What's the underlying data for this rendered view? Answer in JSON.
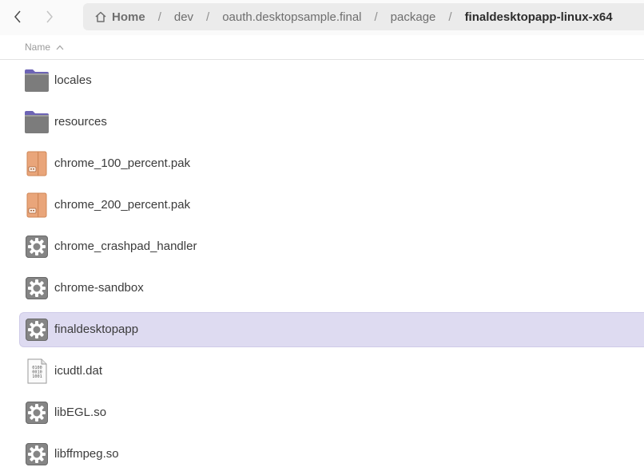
{
  "breadcrumb": {
    "home": "Home",
    "items": [
      "dev",
      "oauth.desktopsample.final",
      "package"
    ],
    "current": "finaldesktopapp-linux-x64",
    "separator": "/"
  },
  "column": {
    "name_label": "Name"
  },
  "files": [
    {
      "name": "locales",
      "icon": "folder-icon"
    },
    {
      "name": "resources",
      "icon": "folder-icon"
    },
    {
      "name": "chrome_100_percent.pak",
      "icon": "archive-icon"
    },
    {
      "name": "chrome_200_percent.pak",
      "icon": "archive-icon"
    },
    {
      "name": "chrome_crashpad_handler",
      "icon": "executable-icon"
    },
    {
      "name": "chrome-sandbox",
      "icon": "executable-icon"
    },
    {
      "name": "finaldesktopapp",
      "icon": "executable-icon",
      "selected": true
    },
    {
      "name": "icudtl.dat",
      "icon": "binary-file-icon",
      "glyph_lines": [
        "0100",
        "0010",
        "1001"
      ]
    },
    {
      "name": "libEGL.so",
      "icon": "executable-icon"
    },
    {
      "name": "libffmpeg.so",
      "icon": "executable-icon"
    }
  ],
  "colors": {
    "selection": "#dedbf1",
    "folder": "#6d64b5",
    "archive": "#e9a57a"
  }
}
